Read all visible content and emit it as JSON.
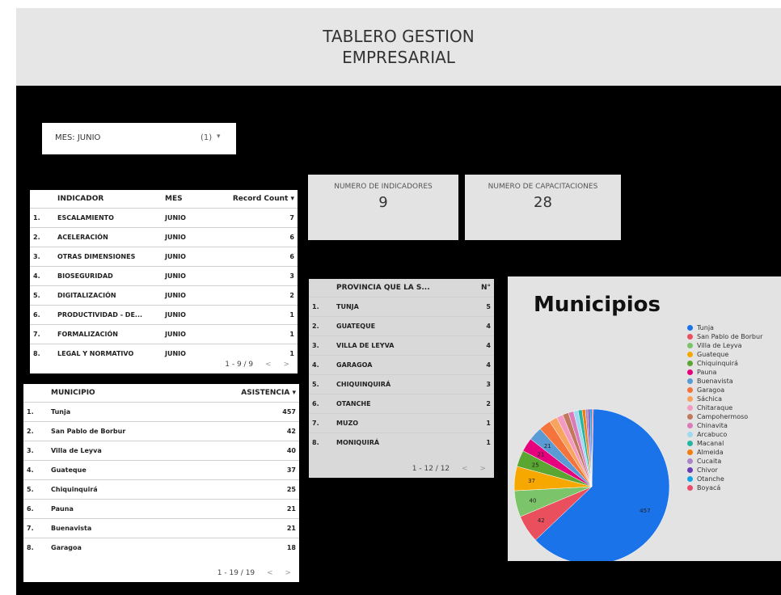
{
  "header": {
    "title_line1": "TABLERO GESTION",
    "title_line2": "EMPRESARIAL"
  },
  "filter": {
    "label": "MES: JUNIO",
    "count": "(1)"
  },
  "kpis": [
    {
      "title": "NUMERO DE INDICADORES",
      "value": "9"
    },
    {
      "title": "NUMERO DE CAPACITACIONES",
      "value": "28"
    }
  ],
  "indicator_table": {
    "headers": [
      "INDICADOR",
      "MES",
      "Record Count"
    ],
    "rows": [
      [
        "1.",
        "ESCALAMIENTO",
        "JUNIO",
        "7"
      ],
      [
        "2.",
        "ACELERACIÓN",
        "JUNIO",
        "6"
      ],
      [
        "3.",
        "OTRAS DIMENSIONES",
        "JUNIO",
        "6"
      ],
      [
        "4.",
        "BIOSEGURIDAD",
        "JUNIO",
        "3"
      ],
      [
        "5.",
        "DIGITALIZACIÓN",
        "JUNIO",
        "2"
      ],
      [
        "6.",
        "PRODUCTIVIDAD - DE...",
        "JUNIO",
        "1"
      ],
      [
        "7.",
        "FORMALIZACIÓN",
        "JUNIO",
        "1"
      ],
      [
        "8.",
        "LEGAL Y NORMATIVO",
        "JUNIO",
        "1"
      ]
    ],
    "pager": "1 - 9 / 9"
  },
  "municipio_table": {
    "headers": [
      "MUNICIPIO",
      "ASISTENCIA"
    ],
    "rows": [
      [
        "1.",
        "Tunja",
        "457"
      ],
      [
        "2.",
        "San Pablo de Borbur",
        "42"
      ],
      [
        "3.",
        "Villa de Leyva",
        "40"
      ],
      [
        "4.",
        "Guateque",
        "37"
      ],
      [
        "5.",
        "Chiquinquirá",
        "25"
      ],
      [
        "6.",
        "Pauna",
        "21"
      ],
      [
        "7.",
        "Buenavista",
        "21"
      ],
      [
        "8.",
        "Garagoa",
        "18"
      ]
    ],
    "pager": "1 - 19 / 19"
  },
  "provincia_table": {
    "headers": [
      "PROVINCIA QUE LA S...",
      "N°"
    ],
    "rows": [
      [
        "1.",
        "TUNJA",
        "5"
      ],
      [
        "2.",
        "GUATEQUE",
        "4"
      ],
      [
        "3.",
        "VILLA DE LEYVA",
        "4"
      ],
      [
        "4.",
        "GARAGOA",
        "4"
      ],
      [
        "5.",
        "CHIQUINQUIRÁ",
        "3"
      ],
      [
        "6.",
        "OTANCHE",
        "2"
      ],
      [
        "7.",
        "MUZO",
        "1"
      ],
      [
        "8.",
        "MONIQUIRÁ",
        "1"
      ]
    ],
    "pager": "1 - 12 / 12"
  },
  "chart_data": {
    "type": "pie",
    "title": "Municipios",
    "slices": [
      {
        "label": "Tunja",
        "value": 457,
        "color": "#1a73e8"
      },
      {
        "label": "San Pablo de Borbur",
        "value": 42,
        "color": "#ea4f5e"
      },
      {
        "label": "Villa de Leyva",
        "value": 40,
        "color": "#7cc46a"
      },
      {
        "label": "Guateque",
        "value": 37,
        "color": "#f7a800"
      },
      {
        "label": "Chiquinquirá",
        "value": 25,
        "color": "#5aa632"
      },
      {
        "label": "Pauna",
        "value": 21,
        "color": "#e6007e"
      },
      {
        "label": "Buenavista",
        "value": 21,
        "color": "#5b9bd5"
      },
      {
        "label": "Garagoa",
        "value": 18,
        "color": "#f4743b"
      },
      {
        "label": "Sáchica",
        "value": 12,
        "color": "#f8a45f"
      },
      {
        "label": "Chitaraque",
        "value": 10,
        "color": "#f49ac1"
      },
      {
        "label": "Campohermoso",
        "value": 9,
        "color": "#c1785e"
      },
      {
        "label": "Chinavita",
        "value": 8,
        "color": "#d97cb9"
      },
      {
        "label": "Arcabuco",
        "value": 7,
        "color": "#9fd9f0"
      },
      {
        "label": "Macanal",
        "value": 6,
        "color": "#26b5a3"
      },
      {
        "label": "Almeida",
        "value": 5,
        "color": "#f27d0c"
      },
      {
        "label": "Cucaita",
        "value": 4,
        "color": "#a984c6"
      },
      {
        "label": "Chivor",
        "value": 3,
        "color": "#6a3fb5"
      },
      {
        "label": "Otanche",
        "value": 3,
        "color": "#12a3e6"
      },
      {
        "label": "Boyacá",
        "value": 2,
        "color": "#ec4c6c"
      }
    ]
  }
}
